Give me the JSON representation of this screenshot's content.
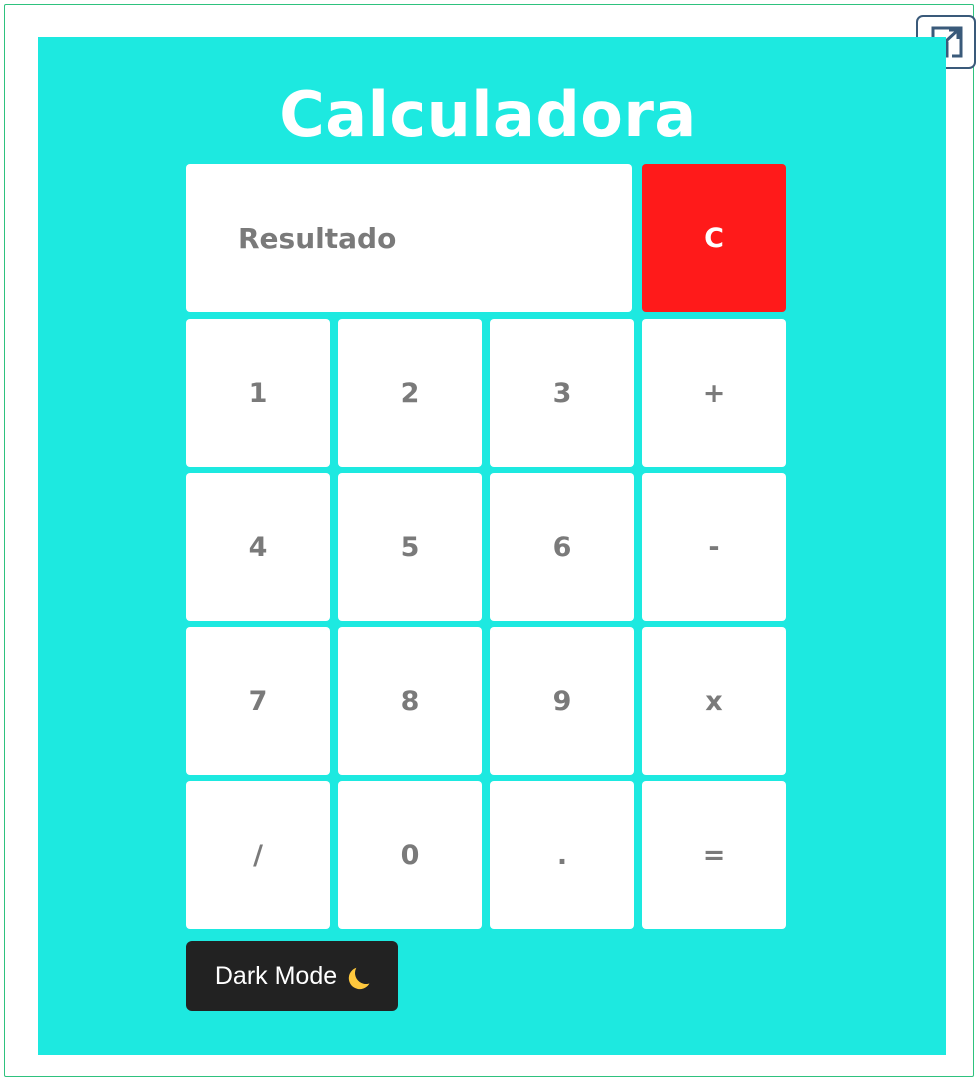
{
  "app": {
    "title": "Calculadora",
    "background_color": "#1de9e0"
  },
  "display": {
    "placeholder": "Resultado",
    "value": ""
  },
  "keys": {
    "clear": "C",
    "row1": [
      "1",
      "2",
      "3",
      "+"
    ],
    "row2": [
      "4",
      "5",
      "6",
      "-"
    ],
    "row3": [
      "7",
      "8",
      "9",
      "x"
    ],
    "row4": [
      "/",
      "0",
      ".",
      "="
    ],
    "clear_color": "#ff1a1a"
  },
  "dark_mode": {
    "label": "Dark Mode",
    "icon": "crescent-moon-icon"
  },
  "toolbar": {
    "expand_icon": "expand-icon"
  }
}
